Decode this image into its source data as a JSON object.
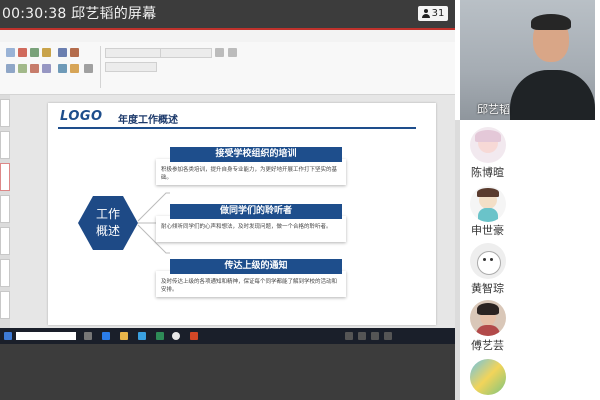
{
  "header": {
    "title": "00:30:38  邱艺韬的屏幕",
    "participant_count": "31",
    "person_icon": "person-icon"
  },
  "slide": {
    "logo": "LOGO",
    "title": "年度工作概述",
    "center_line1": "工作",
    "center_line2": "概述",
    "sections": [
      {
        "heading": "接受学校组织的培训",
        "body": "积极参加各类培训，提升自身专业能力，为更好地开展工作打下坚实的基础。"
      },
      {
        "heading": "做同学们的聆听者",
        "body": "耐心倾听同学们的心声和想法，及时发现问题，做一个合格的聆听者。"
      },
      {
        "heading": "传达上级的通知",
        "body": "及时传达上级的各项通知和精神，保证每个同学都能了解到学校的活动和安排。"
      }
    ]
  },
  "host": {
    "name": "邱艺韬"
  },
  "participants": [
    {
      "name": "陈博暄",
      "avatar": "cartoon-girl-avatar"
    },
    {
      "name": "申世豪",
      "avatar": "cartoon-character-avatar"
    },
    {
      "name": "黄智琮",
      "avatar": "cartoon-cat-avatar"
    },
    {
      "name": "傅艺芸",
      "avatar": "photo-avatar"
    },
    {
      "name": "",
      "avatar": "colorful-avatar"
    }
  ],
  "colors": {
    "accent": "#1e4e8c",
    "ribbon_red": "#c0322c",
    "panel_bg": "#ffffff"
  }
}
